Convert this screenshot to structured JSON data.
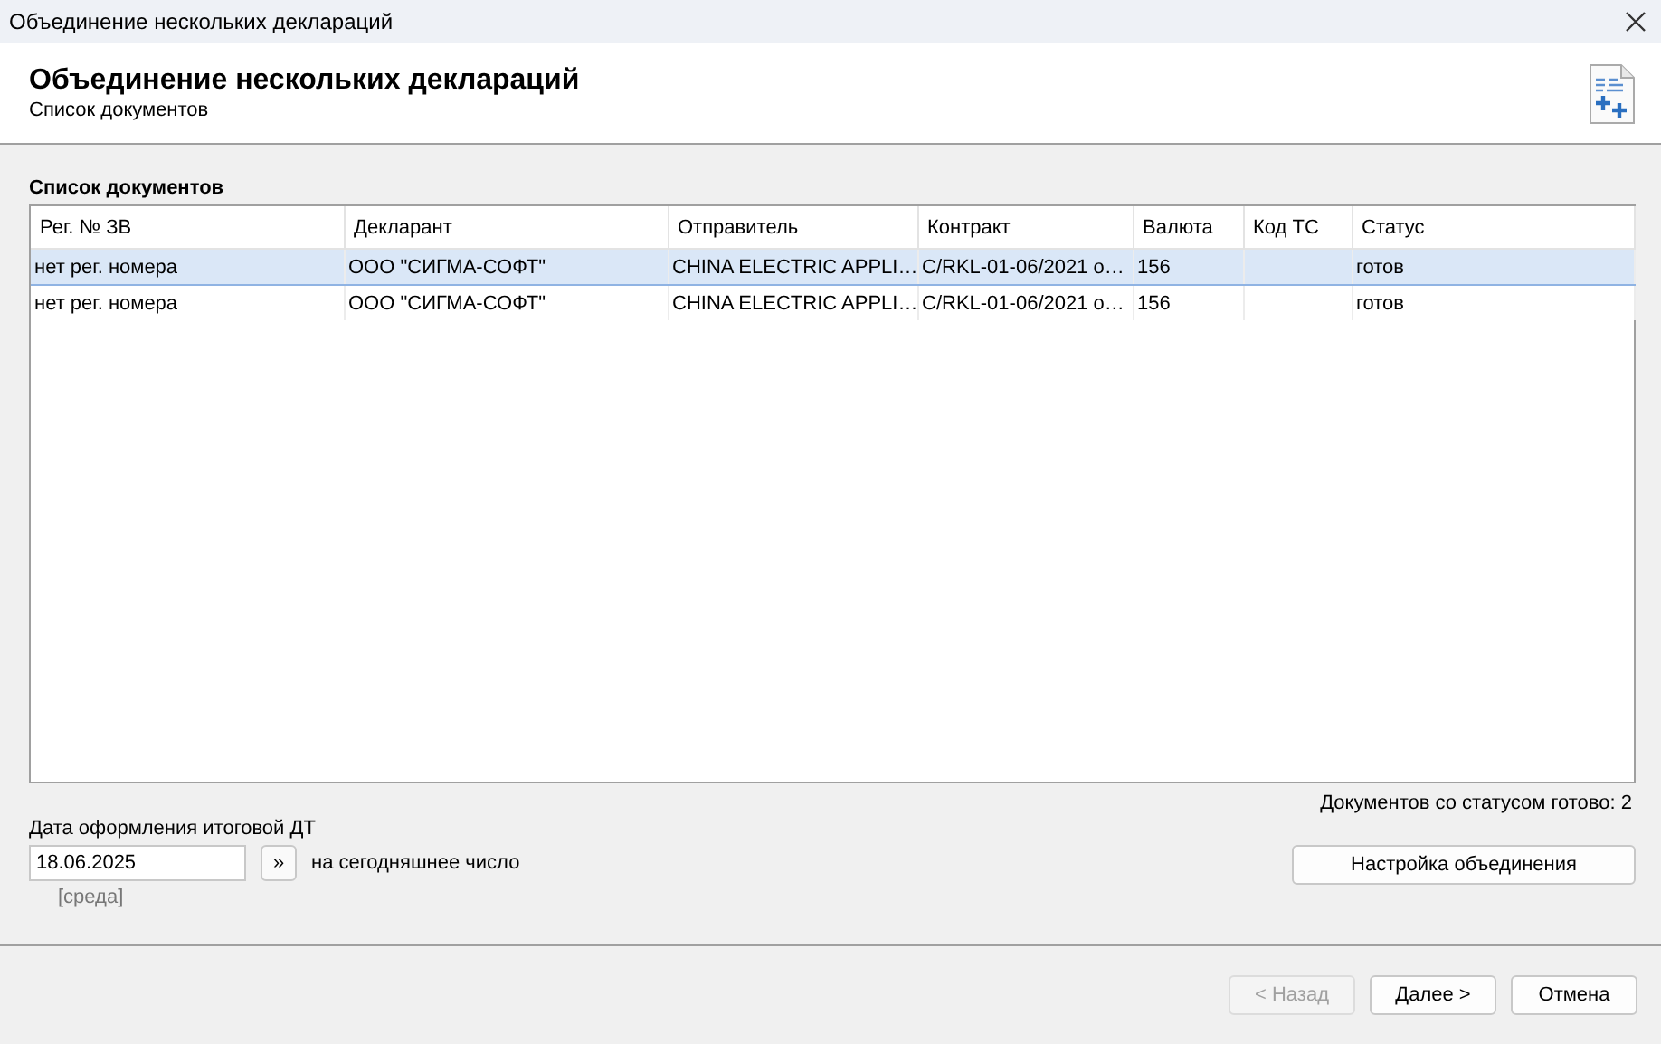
{
  "window": {
    "title": "Объединение нескольких деклараций"
  },
  "header": {
    "title": "Объединение нескольких деклараций",
    "subtitle": "Список документов"
  },
  "section_title": "Список документов",
  "table": {
    "columns": [
      "Рег. № ЗВ",
      "Декларант",
      "Отправитель",
      "Контракт",
      "Валюта",
      "Код ТС",
      "Статус"
    ],
    "rows": [
      {
        "selected": true,
        "cells": [
          "нет рег. номера",
          "ООО \"СИГМА-СОФТ\"",
          "CHINA ELECTRIC APPLI…",
          "C/RKL-01-06/2021 о…",
          "156",
          "",
          "готов"
        ]
      },
      {
        "selected": false,
        "cells": [
          "нет рег. номера",
          "ООО \"СИГМА-СОФТ\"",
          "CHINA ELECTRIC APPLI…",
          "C/RKL-01-06/2021 о…",
          "156",
          "",
          "готов"
        ]
      }
    ]
  },
  "status_count": "Документов со статусом готово: 2",
  "date": {
    "label": "Дата оформления итоговой ДТ",
    "value": "18.06.2025",
    "today_button": "»",
    "today_label": "на сегодняшнее число",
    "weekday": "[среда]"
  },
  "settings_button": "Настройка объединения",
  "buttons": [
    {
      "label": "< Назад",
      "disabled": true
    },
    {
      "label": "Далее >",
      "disabled": false
    },
    {
      "label": "Отмена",
      "disabled": false
    }
  ]
}
